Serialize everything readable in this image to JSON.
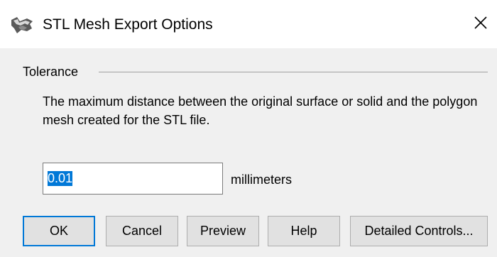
{
  "window": {
    "title": "STL Mesh Export Options",
    "icon": "rhino-app-icon",
    "close_icon": "close-icon"
  },
  "tolerance": {
    "group_label": "Tolerance",
    "description": "The maximum distance between the original surface or solid and the polygon mesh created for the STL file.",
    "value": "0.01",
    "unit": "millimeters"
  },
  "buttons": {
    "ok": "OK",
    "cancel": "Cancel",
    "preview": "Preview",
    "help": "Help",
    "detailed_controls": "Detailed Controls..."
  },
  "colors": {
    "focus_accent": "#0078d7",
    "dialog_background": "#f0f0f0"
  }
}
